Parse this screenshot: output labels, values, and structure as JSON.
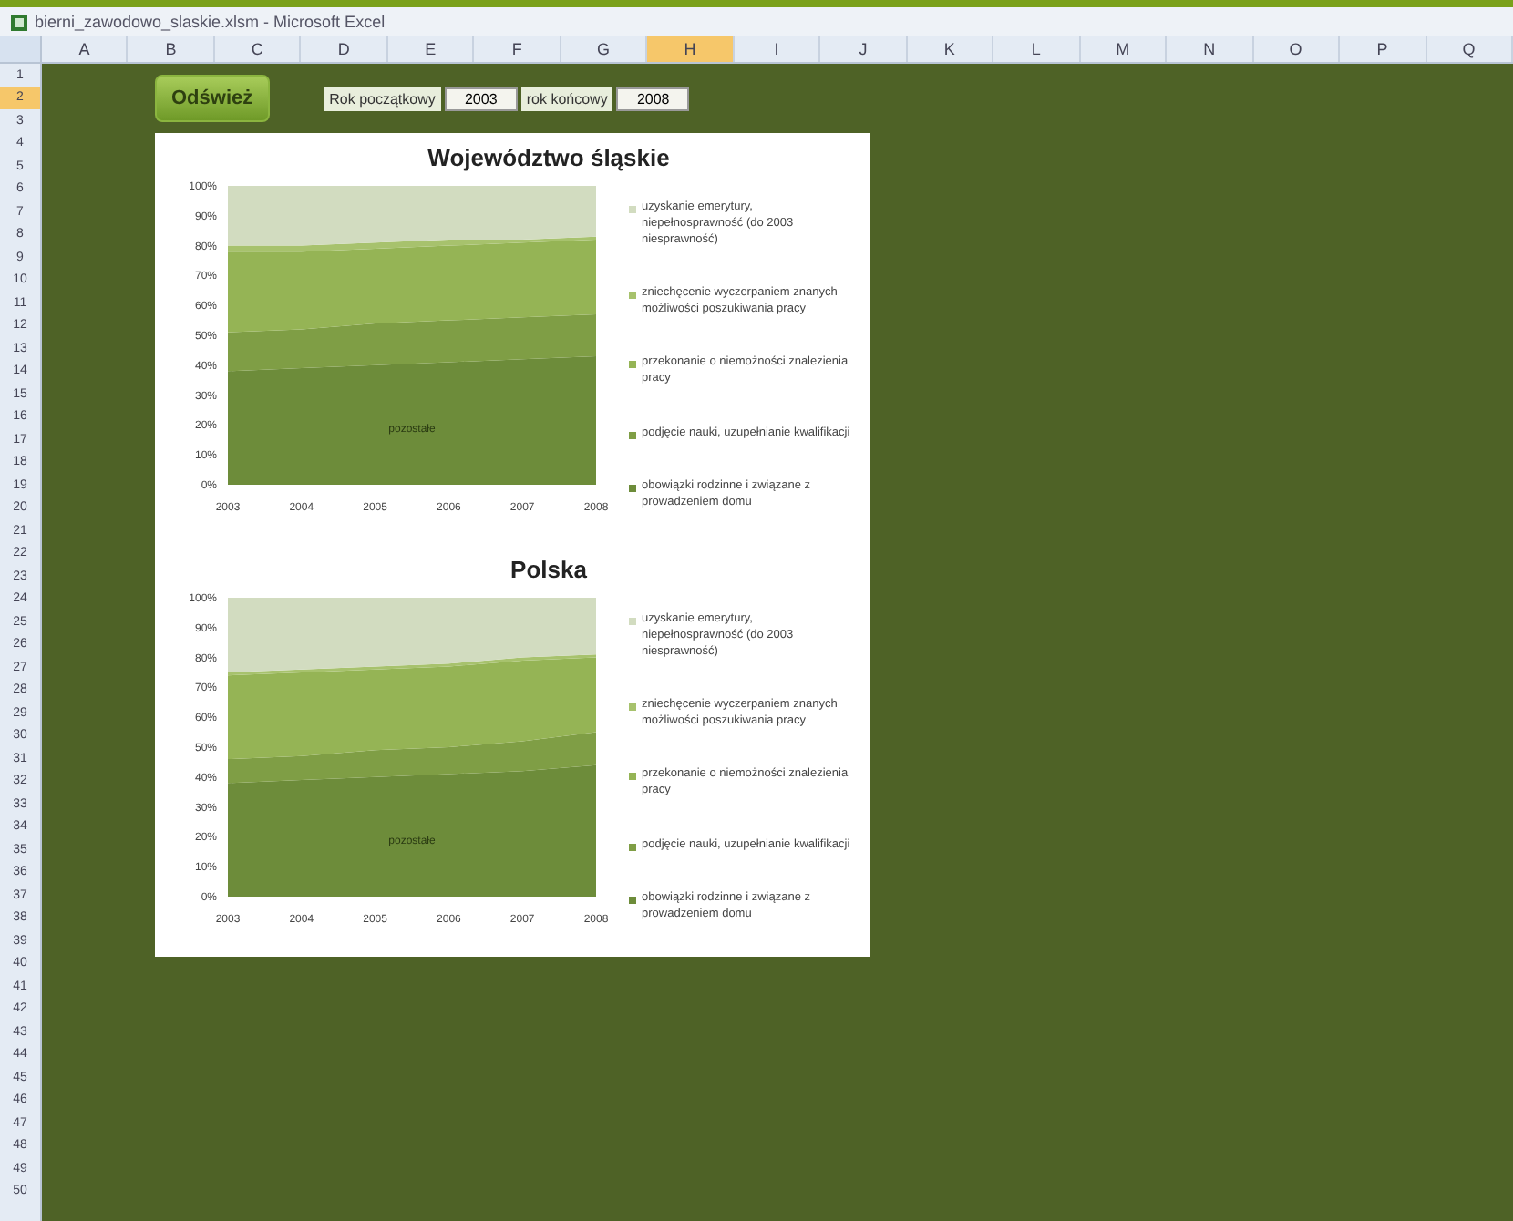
{
  "window": {
    "title": "bierni_zawodowo_slaskie.xlsm - Microsoft Excel"
  },
  "columns": [
    {
      "label": "A",
      "selected": false
    },
    {
      "label": "B",
      "selected": false
    },
    {
      "label": "C",
      "selected": false
    },
    {
      "label": "D",
      "selected": false
    },
    {
      "label": "E",
      "selected": false
    },
    {
      "label": "F",
      "selected": false
    },
    {
      "label": "G",
      "selected": false
    },
    {
      "label": "H",
      "selected": true
    },
    {
      "label": "I",
      "selected": false
    },
    {
      "label": "J",
      "selected": false
    },
    {
      "label": "K",
      "selected": false
    },
    {
      "label": "L",
      "selected": false
    },
    {
      "label": "M",
      "selected": false
    },
    {
      "label": "N",
      "selected": false
    },
    {
      "label": "O",
      "selected": false
    },
    {
      "label": "P",
      "selected": false
    },
    {
      "label": "Q",
      "selected": false
    }
  ],
  "rows": [
    {
      "label": "1",
      "selected": false
    },
    {
      "label": "2",
      "selected": true
    },
    {
      "label": "3",
      "selected": false
    },
    {
      "label": "4",
      "selected": false
    },
    {
      "label": "5",
      "selected": false
    },
    {
      "label": "6",
      "selected": false
    },
    {
      "label": "7",
      "selected": false
    },
    {
      "label": "8",
      "selected": false
    },
    {
      "label": "9",
      "selected": false
    },
    {
      "label": "10",
      "selected": false
    },
    {
      "label": "11",
      "selected": false
    },
    {
      "label": "12",
      "selected": false
    },
    {
      "label": "13",
      "selected": false
    },
    {
      "label": "14",
      "selected": false
    },
    {
      "label": "15",
      "selected": false
    },
    {
      "label": "16",
      "selected": false
    },
    {
      "label": "17",
      "selected": false
    },
    {
      "label": "18",
      "selected": false
    },
    {
      "label": "19",
      "selected": false
    },
    {
      "label": "20",
      "selected": false
    },
    {
      "label": "21",
      "selected": false
    },
    {
      "label": "22",
      "selected": false
    },
    {
      "label": "23",
      "selected": false
    },
    {
      "label": "24",
      "selected": false
    },
    {
      "label": "25",
      "selected": false
    },
    {
      "label": "26",
      "selected": false
    },
    {
      "label": "27",
      "selected": false
    },
    {
      "label": "28",
      "selected": false
    },
    {
      "label": "29",
      "selected": false
    },
    {
      "label": "30",
      "selected": false
    },
    {
      "label": "31",
      "selected": false
    },
    {
      "label": "32",
      "selected": false
    },
    {
      "label": "33",
      "selected": false
    },
    {
      "label": "34",
      "selected": false
    },
    {
      "label": "35",
      "selected": false
    },
    {
      "label": "36",
      "selected": false
    },
    {
      "label": "37",
      "selected": false
    },
    {
      "label": "38",
      "selected": false
    },
    {
      "label": "39",
      "selected": false
    },
    {
      "label": "40",
      "selected": false
    },
    {
      "label": "41",
      "selected": false
    },
    {
      "label": "42",
      "selected": false
    },
    {
      "label": "43",
      "selected": false
    },
    {
      "label": "44",
      "selected": false
    },
    {
      "label": "45",
      "selected": false
    },
    {
      "label": "46",
      "selected": false
    },
    {
      "label": "47",
      "selected": false
    },
    {
      "label": "48",
      "selected": false
    },
    {
      "label": "49",
      "selected": false
    },
    {
      "label": "50",
      "selected": false
    }
  ],
  "controls": {
    "button": "Odśwież",
    "start_label": "Rok początkowy",
    "start_value": "2003",
    "end_label": "rok końcowy",
    "end_value": "2008"
  },
  "charts": [
    {
      "chart_data": {
        "type": "area",
        "stacked": true,
        "title": "Województwo śląskie",
        "categories": [
          "2003",
          "2004",
          "2005",
          "2006",
          "2007",
          "2008"
        ],
        "ylim": [
          0,
          100
        ],
        "yticks": [
          {
            "value": 0,
            "label": "0%"
          },
          {
            "value": 10,
            "label": "10%"
          },
          {
            "value": 20,
            "label": "20%"
          },
          {
            "value": 30,
            "label": "30%"
          },
          {
            "value": 40,
            "label": "40%"
          },
          {
            "value": 50,
            "label": "50%"
          },
          {
            "value": 60,
            "label": "60%"
          },
          {
            "value": 70,
            "label": "70%"
          },
          {
            "value": 80,
            "label": "80%"
          },
          {
            "value": 90,
            "label": "90%"
          },
          {
            "value": 100,
            "label": "100%"
          }
        ],
        "annotations": [
          {
            "text": "pozostałe"
          }
        ],
        "series": [
          {
            "name": "obowiązki rodzinne i związane z prowadzeniem domu",
            "color": "#6d8c3a",
            "values": [
              38,
              39,
              40,
              41,
              42,
              43
            ]
          },
          {
            "name": "podjęcie nauki, uzupełnianie kwalifikacji",
            "color": "#7f9e45",
            "values": [
              13,
              13,
              14,
              14,
              14,
              14
            ]
          },
          {
            "name": "przekonanie o niemożności znalezienia pracy",
            "color": "#95b455",
            "values": [
              27,
              26,
              25,
              25,
              25,
              25
            ]
          },
          {
            "name": "zniechęcenie wyczerpaniem znanych możliwości poszukiwania pracy",
            "color": "#a7c26d",
            "values": [
              2,
              2,
              2,
              2,
              1,
              1
            ]
          },
          {
            "name": "uzyskanie emerytury, niepełnosprawność (do 2003 niesprawność)",
            "color": "#d2dcc0",
            "values": [
              20,
              20,
              19,
              18,
              18,
              17
            ]
          }
        ]
      }
    },
    {
      "chart_data": {
        "type": "area",
        "stacked": true,
        "title": "Polska",
        "categories": [
          "2003",
          "2004",
          "2005",
          "2006",
          "2007",
          "2008"
        ],
        "ylim": [
          0,
          100
        ],
        "yticks": [
          {
            "value": 0,
            "label": "0%"
          },
          {
            "value": 10,
            "label": "10%"
          },
          {
            "value": 20,
            "label": "20%"
          },
          {
            "value": 30,
            "label": "30%"
          },
          {
            "value": 40,
            "label": "40%"
          },
          {
            "value": 50,
            "label": "50%"
          },
          {
            "value": 60,
            "label": "60%"
          },
          {
            "value": 70,
            "label": "70%"
          },
          {
            "value": 80,
            "label": "80%"
          },
          {
            "value": 90,
            "label": "90%"
          },
          {
            "value": 100,
            "label": "100%"
          }
        ],
        "annotations": [
          {
            "text": "pozostałe"
          }
        ],
        "series": [
          {
            "name": "obowiązki rodzinne i związane z prowadzeniem domu",
            "color": "#6d8c3a",
            "values": [
              38,
              39,
              40,
              41,
              42,
              44
            ]
          },
          {
            "name": "podjęcie nauki, uzupełnianie kwalifikacji",
            "color": "#7f9e45",
            "values": [
              8,
              8,
              9,
              9,
              10,
              11
            ]
          },
          {
            "name": "przekonanie o niemożności znalezienia pracy",
            "color": "#95b455",
            "values": [
              28,
              28,
              27,
              27,
              27,
              25
            ]
          },
          {
            "name": "zniechęcenie wyczerpaniem znanych możliwości poszukiwania pracy",
            "color": "#a7c26d",
            "values": [
              1,
              1,
              1,
              1,
              1,
              1
            ]
          },
          {
            "name": "uzyskanie emerytury, niepełnosprawność (do 2003 niesprawność)",
            "color": "#d2dcc0",
            "values": [
              25,
              24,
              23,
              22,
              20,
              19
            ]
          }
        ]
      }
    }
  ]
}
